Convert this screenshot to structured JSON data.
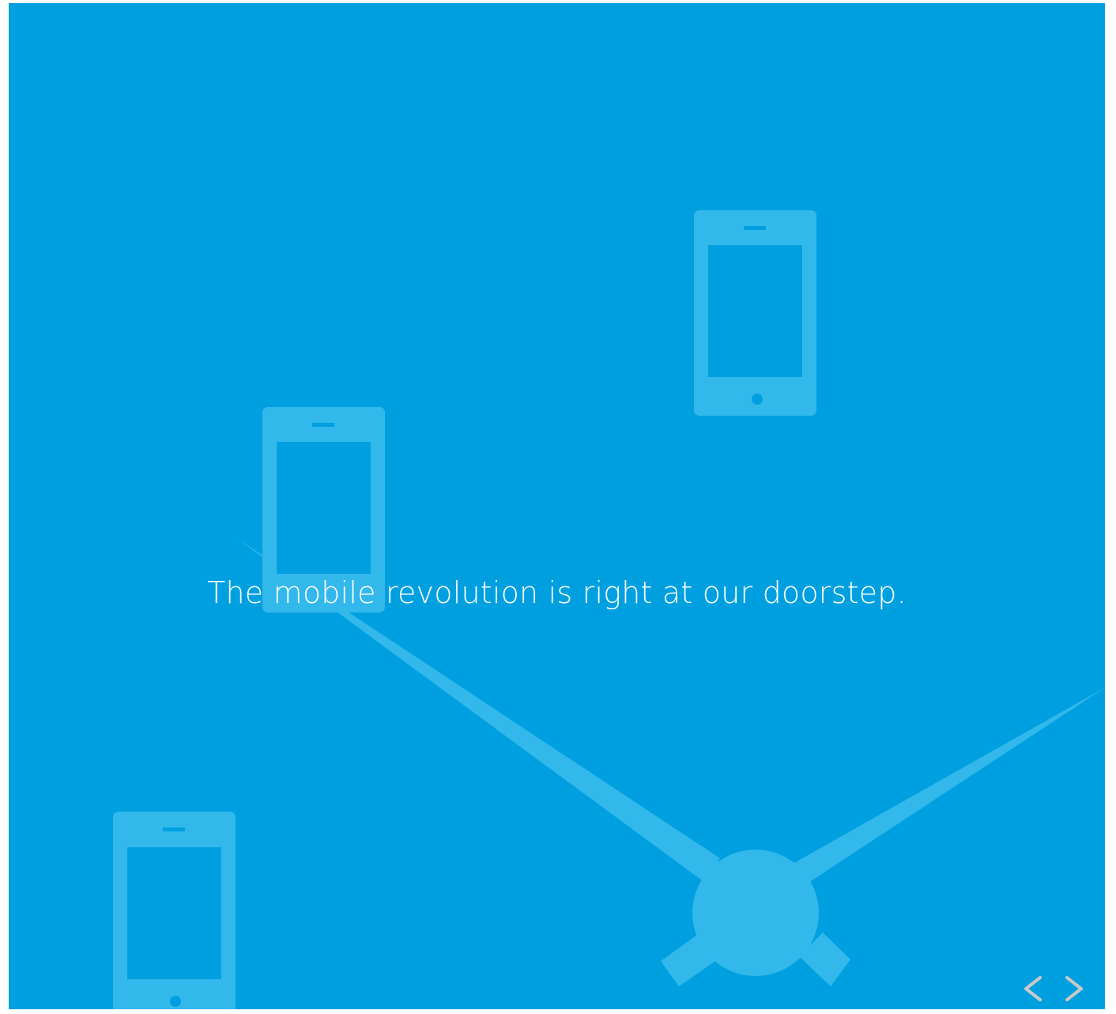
{
  "slide": {
    "caption": "The mobile revolution is right at our doorstep.",
    "background_color": "#00a0e0",
    "shape_color": "#33b8ec"
  },
  "icons": {
    "phone": "mobile-phone-icon",
    "clock": "clock-icon"
  },
  "navigation": {
    "prev_icon": "chevron-left-icon",
    "next_icon": "chevron-right-icon",
    "arrow_color": "#c9c9c9"
  }
}
